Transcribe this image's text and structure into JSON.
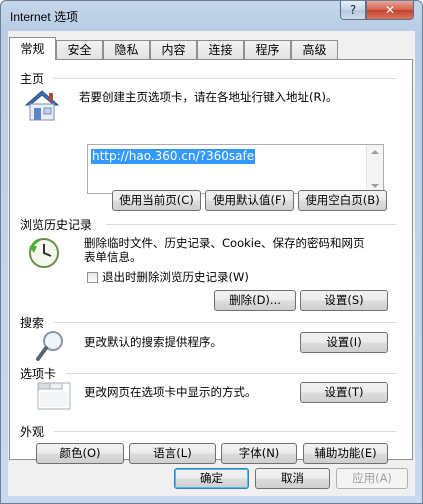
{
  "window": {
    "title": "Internet 选项",
    "help_symbol": "?",
    "close_symbol": "✕"
  },
  "tabs": [
    {
      "label": "常规",
      "active": true
    },
    {
      "label": "安全"
    },
    {
      "label": "隐私"
    },
    {
      "label": "内容"
    },
    {
      "label": "连接"
    },
    {
      "label": "程序"
    },
    {
      "label": "高级"
    }
  ],
  "home": {
    "section_label": "主页",
    "description": "若要创建主页选项卡，请在各地址行键入地址(R)。",
    "url": "http://hao.360.cn/?360safe",
    "use_current_label": "使用当前页(C)",
    "use_default_label": "使用默认值(F)",
    "use_blank_label": "使用空白页(B)",
    "icon": "house-icon"
  },
  "history": {
    "section_label": "浏览历史记录",
    "description_line1": "删除临时文件、历史记录、Cookie、保存的密码和网页",
    "description_line2": "表单信息。",
    "checkbox_label": "退出时删除浏览历史记录(W)",
    "checkbox_checked": false,
    "delete_label": "删除(D)...",
    "settings_label": "设置(S)",
    "icon": "history-clock-icon"
  },
  "search": {
    "section_label": "搜索",
    "description": "更改默认的搜索提供程序。",
    "settings_label": "设置(I)",
    "icon": "magnifier-icon"
  },
  "tabbed": {
    "section_label": "选项卡",
    "description": "更改网页在选项卡中显示的方式。",
    "settings_label": "设置(T)",
    "icon": "tabs-window-icon"
  },
  "appearance": {
    "section_label": "外观",
    "colors_label": "颜色(O)",
    "languages_label": "语言(L)",
    "fonts_label": "字体(N)",
    "accessibility_label": "辅助功能(E)"
  },
  "footer": {
    "ok_label": "确定",
    "cancel_label": "取消",
    "apply_label": "应用(A)"
  },
  "colors": {
    "selection": "#3399ff",
    "close_button": "#c2412b",
    "title_bar": "#b9cde5"
  }
}
